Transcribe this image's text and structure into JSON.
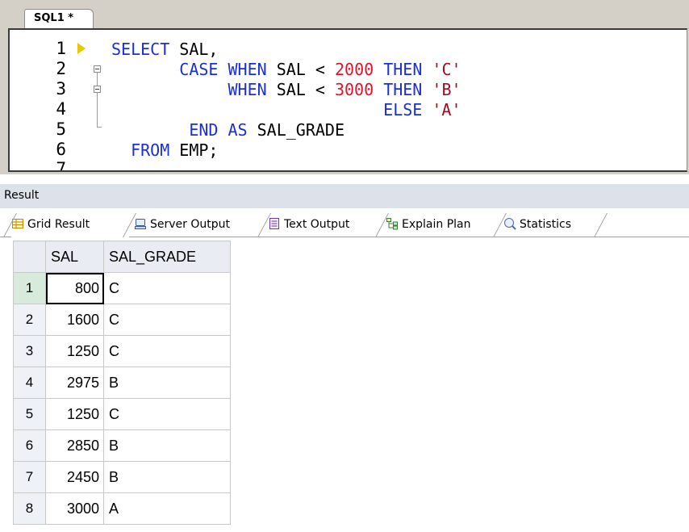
{
  "editor": {
    "tab_label": "SQL1 *",
    "line_numbers": [
      "1",
      "2",
      "3",
      "4",
      "5",
      "6",
      "7"
    ]
  },
  "result": {
    "title": "Result",
    "tabs": [
      {
        "label": "Grid Result",
        "icon": "grid-icon"
      },
      {
        "label": "Server Output",
        "icon": "server-output-icon"
      },
      {
        "label": "Text Output",
        "icon": "text-output-icon"
      },
      {
        "label": "Explain Plan",
        "icon": "explain-plan-icon"
      },
      {
        "label": "Statistics",
        "icon": "statistics-icon"
      }
    ],
    "columns": [
      "SAL",
      "SAL_GRADE"
    ],
    "rows": [
      {
        "n": "1",
        "sal": "800",
        "grade": "C"
      },
      {
        "n": "2",
        "sal": "1600",
        "grade": "C"
      },
      {
        "n": "3",
        "sal": "1250",
        "grade": "C"
      },
      {
        "n": "4",
        "sal": "2975",
        "grade": "B"
      },
      {
        "n": "5",
        "sal": "1250",
        "grade": "C"
      },
      {
        "n": "6",
        "sal": "2850",
        "grade": "B"
      },
      {
        "n": "7",
        "sal": "2450",
        "grade": "B"
      },
      {
        "n": "8",
        "sal": "3000",
        "grade": "A"
      }
    ]
  },
  "colors": {
    "keyword": "#1a2fd6",
    "number": "#e0142a",
    "string": "#9a1020",
    "header_bg": "#dde2ea"
  }
}
